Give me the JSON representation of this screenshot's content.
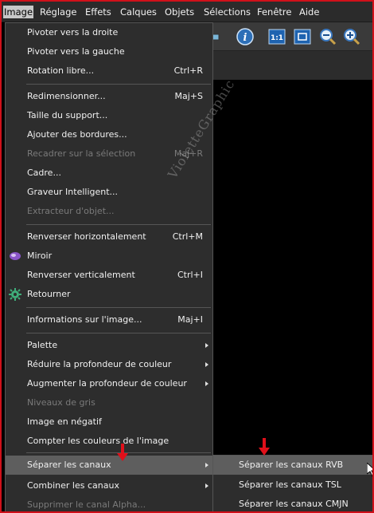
{
  "menubar": {
    "items": [
      {
        "label": "Image",
        "active": true
      },
      {
        "label": "Réglage"
      },
      {
        "label": "Effets"
      },
      {
        "label": "Calques"
      },
      {
        "label": "Objets"
      },
      {
        "label": "Sélections"
      },
      {
        "label": "Fenêtre"
      },
      {
        "label": "Aide"
      }
    ]
  },
  "toolbar": {
    "icons": [
      "info-icon",
      "actual-size-icon",
      "fit-window-icon",
      "zoom-out-icon",
      "zoom-in-icon"
    ],
    "zoom_label": "1:1"
  },
  "menu": {
    "items": [
      {
        "label": "Pivoter vers la droite"
      },
      {
        "label": "Pivoter vers la gauche"
      },
      {
        "label": "Rotation libre...",
        "shortcut": "Ctrl+R"
      },
      {
        "label": "Redimensionner...",
        "shortcut": "Maj+S"
      },
      {
        "label": "Taille du support..."
      },
      {
        "label": "Ajouter des bordures..."
      },
      {
        "label": "Recadrer sur la sélection",
        "shortcut": "Maj+R",
        "disabled": true
      },
      {
        "label": "Cadre..."
      },
      {
        "label": "Graveur Intelligent..."
      },
      {
        "label": "Extracteur d'objet...",
        "disabled": true
      },
      {
        "label": "Renverser horizontalement",
        "shortcut": "Ctrl+M"
      },
      {
        "label": "Miroir"
      },
      {
        "label": "Renverser verticalement",
        "shortcut": "Ctrl+I"
      },
      {
        "label": "Retourner"
      },
      {
        "label": "Informations sur l'image...",
        "shortcut": "Maj+I"
      },
      {
        "label": "Palette"
      },
      {
        "label": "Réduire la profondeur de couleur"
      },
      {
        "label": "Augmenter la profondeur de couleur"
      },
      {
        "label": "Niveaux de gris",
        "disabled": true
      },
      {
        "label": "Image en négatif"
      },
      {
        "label": "Compter les couleurs de l'image"
      },
      {
        "label": "Séparer les canaux"
      },
      {
        "label": "Combiner les canaux"
      },
      {
        "label": "Supprimer le canal Alpha...",
        "disabled": true
      }
    ]
  },
  "submenu": {
    "items": [
      {
        "label": "Séparer les canaux RVB"
      },
      {
        "label": "Séparer les canaux TSL"
      },
      {
        "label": "Séparer les canaux CMJN"
      }
    ]
  },
  "watermark": {
    "text": "VioletteGraphic"
  },
  "colors": {
    "frame_border": "#d0101a",
    "menu_bg": "#2d2d2d",
    "highlight": "#5e5e5e",
    "annotation_arrow": "#e0101a"
  }
}
